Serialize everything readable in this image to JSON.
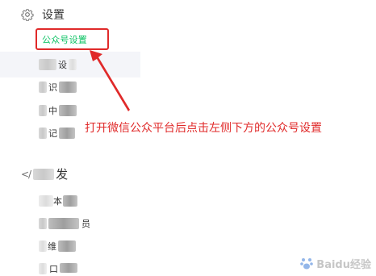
{
  "settings_section": {
    "title": "设置",
    "icon": "gear-icon",
    "highlighted_item": "公众号设置"
  },
  "settings_items": [
    {
      "visible_fragment": "设"
    },
    {
      "visible_fragment": "识"
    },
    {
      "visible_fragment": "中"
    },
    {
      "visible_fragment": "记"
    }
  ],
  "dev_section": {
    "title": "发",
    "icon": "code-icon",
    "icon_glyph": "</"
  },
  "dev_items": [
    {
      "visible_fragment": "本"
    },
    {
      "visible_fragment": "员"
    },
    {
      "visible_fragment": "维"
    },
    {
      "visible_fragment": "口"
    }
  ],
  "annotation": {
    "text": "打开微信公众平台后点击左侧下方的公众号设置",
    "color": "#e02a2a"
  },
  "watermark": {
    "text": "Baidu经验"
  },
  "colors": {
    "highlight_border": "#e02a2a",
    "active_green": "#07c160",
    "text": "#353535",
    "active_row_bg": "#f4f5f9"
  }
}
